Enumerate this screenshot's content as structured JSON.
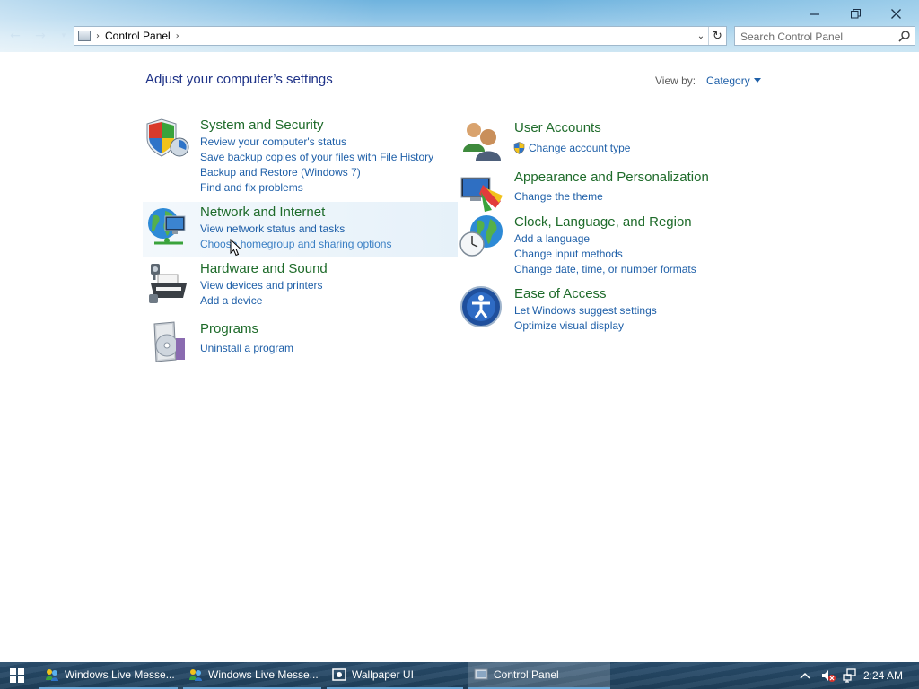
{
  "window": {
    "minimize_icon": "minimize-icon",
    "maximize_icon": "restore-icon",
    "close_icon": "close-icon"
  },
  "address": {
    "crumb": "Control Panel",
    "separator_glyph": "›"
  },
  "search": {
    "placeholder": "Search Control Panel"
  },
  "header": {
    "title": "Adjust your computer’s settings",
    "view_by_label": "View by:",
    "view_by_value": "Category"
  },
  "categories": [
    {
      "title": "System and Security",
      "icon": "shield-icon",
      "links": [
        "Review your computer's status",
        "Save backup copies of your files with File History",
        "Backup and Restore (Windows 7)",
        "Find and fix problems"
      ]
    },
    {
      "title": "Network and Internet",
      "icon": "globe-network-icon",
      "links": [
        "View network status and tasks",
        "Choose homegroup and sharing options"
      ]
    },
    {
      "title": "Hardware and Sound",
      "icon": "printer-icon",
      "links": [
        "View devices and printers",
        "Add a device"
      ]
    },
    {
      "title": "Programs",
      "icon": "programs-icon",
      "links": [
        "Uninstall a program"
      ]
    },
    {
      "title": "User Accounts",
      "icon": "users-icon",
      "links": [
        "Change account type"
      ]
    },
    {
      "title": "Appearance and Personalization",
      "icon": "monitor-palette-icon",
      "links": [
        "Change the theme"
      ]
    },
    {
      "title": "Clock, Language, and Region",
      "icon": "clock-globe-icon",
      "links": [
        "Add a language",
        "Change input methods",
        "Change date, time, or number formats"
      ]
    },
    {
      "title": "Ease of Access",
      "icon": "ease-of-access-icon",
      "links": [
        "Let Windows suggest settings",
        "Optimize visual display"
      ]
    }
  ],
  "taskbar": {
    "tasks": [
      {
        "label": "Windows Live Messe...",
        "icon": "messenger-icon"
      },
      {
        "label": "Windows Live Messe...",
        "icon": "messenger-icon"
      },
      {
        "label": "Wallpaper UI",
        "icon": "wallpaper-icon"
      },
      {
        "label": "Control Panel",
        "icon": "control-panel-icon"
      }
    ],
    "clock": "2:24 AM"
  },
  "colors": {
    "link": "#1e5fa8",
    "category_title": "#1e6b2a",
    "heading": "#1e3287",
    "taskbar": "#1f3f5a"
  }
}
